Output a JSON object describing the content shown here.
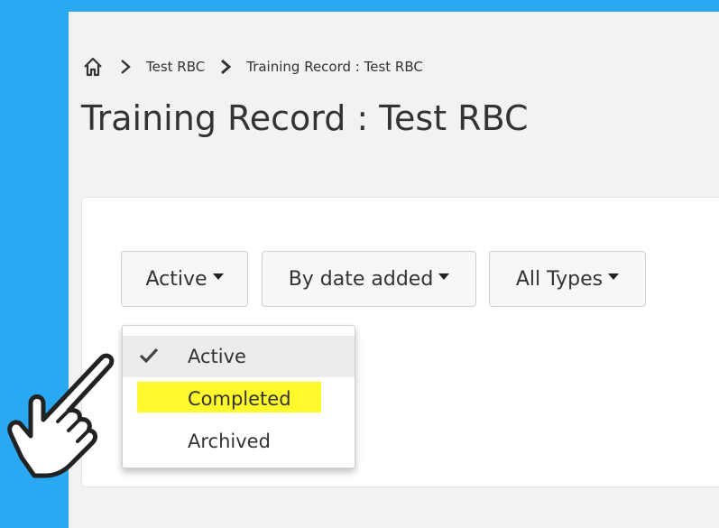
{
  "breadcrumb": {
    "items": [
      "Test RBC",
      "Training Record : Test RBC"
    ]
  },
  "page_title": "Training Record : Test RBC",
  "filters": {
    "status_label": "Active",
    "sort_label": "By date added",
    "types_label": "All Types"
  },
  "dropdown": {
    "items": [
      "Active",
      "Completed",
      "Archived"
    ],
    "selected": "Active",
    "highlighted": "Completed"
  },
  "colors": {
    "background": "#2aa8f2",
    "highlight": "#fff82a"
  },
  "icons": [
    "home-icon",
    "chevron-right-icon",
    "check-icon",
    "pointing-hand-icon"
  ]
}
